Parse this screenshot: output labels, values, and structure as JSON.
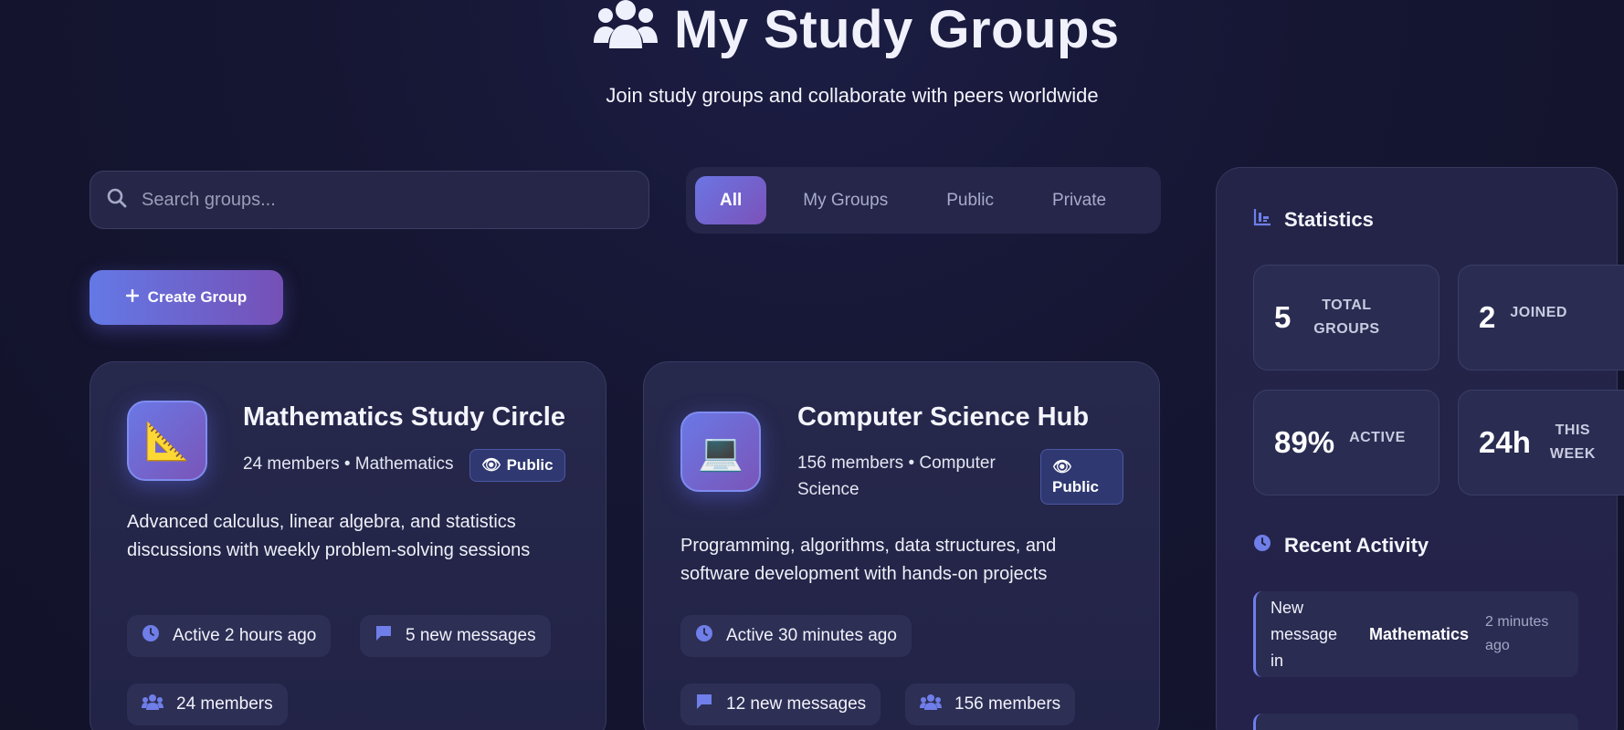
{
  "header": {
    "title": "My Study Groups",
    "subtitle": "Join study groups and collaborate with peers worldwide",
    "icon": "users-icon"
  },
  "search": {
    "placeholder": "Search groups...",
    "value": ""
  },
  "filters": {
    "tabs": [
      "All",
      "My Groups",
      "Public",
      "Private"
    ],
    "active": "All"
  },
  "create_button": {
    "label": "Create Group"
  },
  "groups": [
    {
      "icon": "triangle-ruler-icon",
      "emoji": "📐",
      "title": "Mathematics Study Circle",
      "meta": "24 members • Mathematics",
      "badge": "Public",
      "description": "Advanced calculus, linear algebra, and statistics discussions with weekly problem-solving sessions",
      "active": "Active 2 hours ago",
      "messages": "5 new messages",
      "members": "24 members"
    },
    {
      "icon": "laptop-icon",
      "emoji": "💻",
      "title": "Computer Science Hub",
      "meta": "156 members • Computer Science",
      "badge": "Public",
      "description": "Programming, algorithms, data structures, and software development with hands-on projects",
      "active": "Active 30 minutes ago",
      "messages": "12 new messages",
      "members": "156 members"
    }
  ],
  "statistics": {
    "heading": "Statistics",
    "items": [
      {
        "value": "5",
        "label": "TOTAL GROUPS"
      },
      {
        "value": "2",
        "label": "JOINED"
      },
      {
        "value": "89%",
        "label": "ACTIVE"
      },
      {
        "value": "24h",
        "label": "THIS WEEK"
      }
    ]
  },
  "recent_activity": {
    "heading": "Recent Activity",
    "items": [
      {
        "text": "New message in",
        "subject": "Mathematics",
        "time": "2 minutes ago"
      }
    ]
  },
  "colors": {
    "accent": "#6f7ee8",
    "accent2": "#7a55b8",
    "background": "#151632"
  }
}
